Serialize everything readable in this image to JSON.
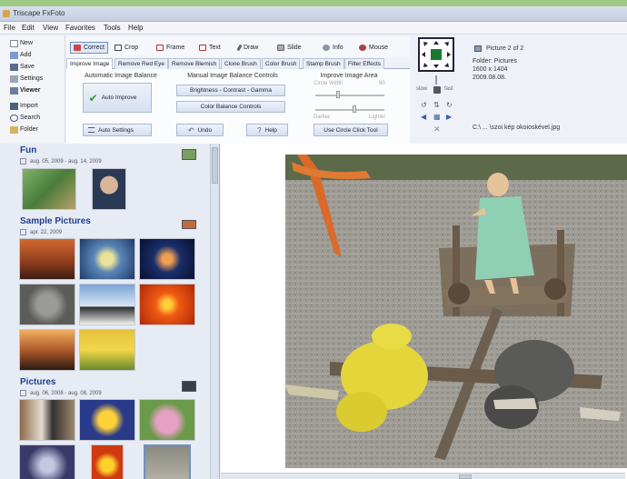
{
  "app": {
    "title": "Triscape FxFoto"
  },
  "menu": [
    "File",
    "Edit",
    "View",
    "Favorites",
    "Tools",
    "Help"
  ],
  "left_commands": [
    "New",
    "Add",
    "Save",
    "Settings",
    "Viewer",
    "Import",
    "Search",
    "Folder"
  ],
  "tools": [
    "Correct",
    "Crop",
    "Frame",
    "Text",
    "Draw",
    "Slide",
    "Info",
    "Mouse"
  ],
  "tabs": [
    "Improve Image",
    "Remove Red Eye",
    "Remove Blemish",
    "Clone Brush",
    "Color Brush",
    "Stamp Brush",
    "Filter Effects"
  ],
  "panel": {
    "auto_group": "Automatic Image Balance",
    "manual_group": "Manual Image Balance Controls",
    "area_group": "Improve Image Area",
    "auto_improve": "Auto Improve",
    "auto_settings": "Auto Settings",
    "bcg": "Brightness - Contrast - Gamma",
    "color_balance": "Color Balance Controls",
    "undo": "Undo",
    "help": "Help",
    "circle_width": "Circle Width",
    "circle_width_value": "90",
    "darker": "Darker",
    "lighter": "Lighter",
    "use_circle": "Use Circle Click Tool"
  },
  "nav": {
    "slow": "slow",
    "fast": "fast"
  },
  "info": {
    "picture": "Picture 2 of 2",
    "folder": "Folder: Pictures",
    "size": "1600 x 1404",
    "date": "2009.08.08.",
    "path": "C:\\ ... \\szoi kép okoioskével.jpg"
  },
  "albums": [
    {
      "title": "Fun",
      "dates": "aug. 05, 2009 - aug. 14, 2009"
    },
    {
      "title": "Sample Pictures",
      "dates": "apr. 22, 2009"
    },
    {
      "title": "Pictures",
      "dates": "aug. 06, 2008 - aug. 08, 2009"
    }
  ],
  "colors": {
    "accent": "#1f3f8f",
    "button_top": "#eef2fa",
    "button_bottom": "#d6e0f2",
    "page_bg": "#9fca86"
  }
}
